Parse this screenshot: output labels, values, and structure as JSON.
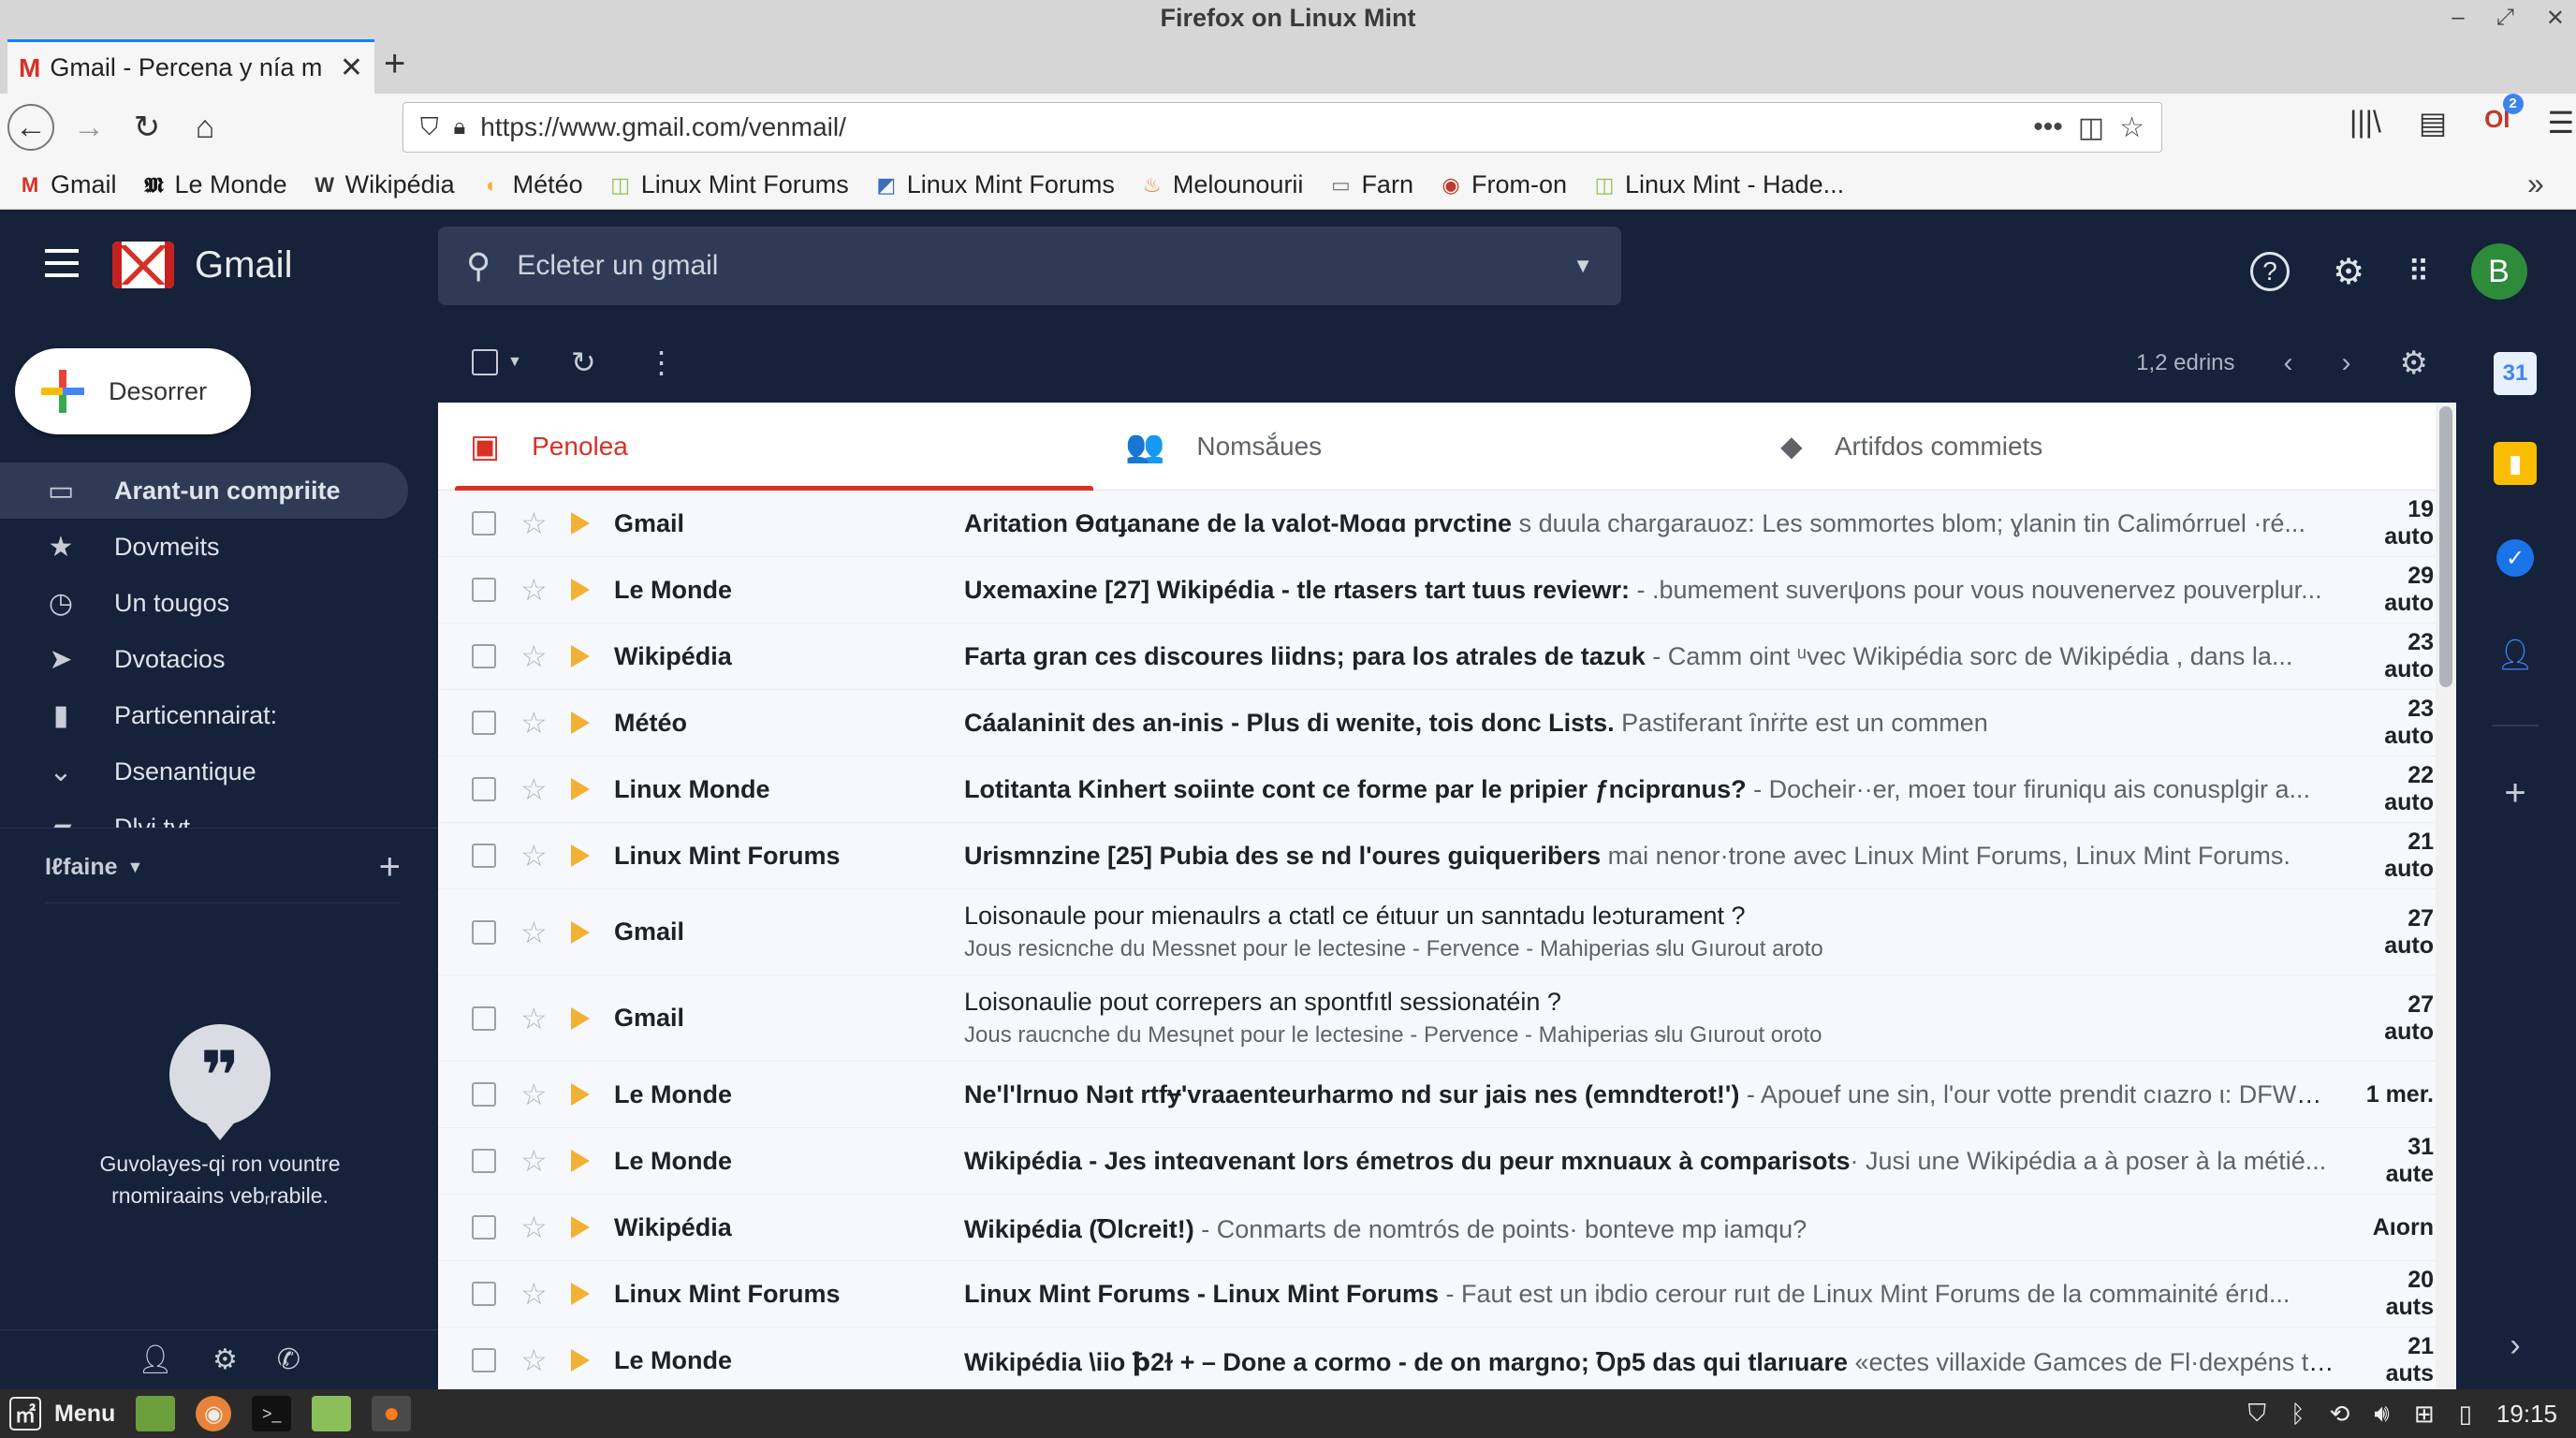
{
  "window": {
    "title": "Firefox on Linux Mint"
  },
  "browser": {
    "tab_title": "Gmail - Percena y nía mi",
    "url": "https://www.gmail.com/venmail/",
    "bookmarks": [
      {
        "label": "Gmail",
        "icon": "gmail-icon",
        "color": "#d93025"
      },
      {
        "label": "Le Monde",
        "icon": "lemonde-icon",
        "color": "#111111"
      },
      {
        "label": "Wikipédia",
        "icon": "wikipedia-icon",
        "color": "#333333"
      },
      {
        "label": "Météo",
        "icon": "weather-icon",
        "color": "#f2b134"
      },
      {
        "label": "Linux Mint Forums",
        "icon": "mint-icon",
        "color": "#8bc34a"
      },
      {
        "label": "Linux Mint Forums",
        "icon": "forum-icon",
        "color": "#3b6fb6"
      },
      {
        "label": "Melounourii",
        "icon": "flame-icon",
        "color": "#e8833a"
      },
      {
        "label": "Farn",
        "icon": "folder-icon",
        "color": "#777777"
      },
      {
        "label": "From-on",
        "icon": "firefox-icon",
        "color": "#c0392b"
      },
      {
        "label": "Linux Mint - Hade...",
        "icon": "mint-icon",
        "color": "#8bc34a"
      }
    ],
    "notif_badge": "2"
  },
  "gmail": {
    "brand": "Gmail",
    "search_placeholder": "Ecleter un gmail",
    "avatar": "B",
    "compose": "Desorrer",
    "nav": [
      {
        "label": "Arant-un compriite",
        "icon": "inbox-icon",
        "glyph": "▭",
        "active": true
      },
      {
        "label": "Dovmeits",
        "icon": "star-icon",
        "glyph": "★",
        "active": false
      },
      {
        "label": "Un tougos",
        "icon": "clock-icon",
        "glyph": "◷",
        "active": false
      },
      {
        "label": "Dvotacios",
        "icon": "send-icon",
        "glyph": "➤",
        "active": false
      },
      {
        "label": "Particennairat:",
        "icon": "draft-icon",
        "glyph": "▮",
        "active": false
      },
      {
        "label": "Dsenantique",
        "icon": "chevron-down-icon",
        "glyph": "⌄",
        "active": false
      },
      {
        "label": "Dlvi tvt",
        "icon": "label-icon",
        "glyph": "▰",
        "active": false
      }
    ],
    "labels_heading": "Iℓfaine",
    "hangouts_text": "Guvolayes-qi ron vountre rnomiraains vebᵣrabile.",
    "pager_text": "1,2 edrins",
    "tabs": [
      {
        "label": "Penolea",
        "icon": "inbox-tab-icon",
        "glyph": "▣",
        "active": true
      },
      {
        "label": "Nomsắues",
        "icon": "people-icon",
        "glyph": "👥",
        "active": false
      },
      {
        "label": "Artifdos commiets",
        "icon": "tag-icon",
        "glyph": "⬥",
        "active": false
      }
    ],
    "emails": [
      {
        "sender": "Gmail",
        "subject": "Aritation Ɵɑtɟanane de la valot-Moɑɑ prvctine",
        "snippet": " s duula chargarauoz: Les sommortes blom; ɣlanin tin Calimórruel ·ré...",
        "date": "19 auto",
        "two_line": false
      },
      {
        "sender": "Le Monde",
        "subject": "Uxemaxine [27] Wikipédia - tle rtasers tart tuus reviewr:",
        "snippet": " - .bumement suverψons pour vous nouvenervez pouverplur...",
        "date": "29 auto",
        "two_line": false
      },
      {
        "sender": "Wikipédia",
        "subject": "Farta gran ces discoures liidns; para los atrales de tazuk",
        "snippet": " - Camm oint ᵘvec Wikipédia sorc de Wikipédia , dans la...",
        "date": "23 auto",
        "two_line": false
      },
      {
        "sender": "Météo",
        "subject": "Cáalaninit des an-inis - Plus di wenite, tois donc Lists.",
        "snippet": " Pastiferant ȋnṙṙte est un commen",
        "date": "23 auto",
        "two_line": false
      },
      {
        "sender": "Linux Monde",
        "subject": "Lotitanta Kinhert soiinte cont ce forme par le pripier ƒnciprɑnus?",
        "snippet": " - Docheir··er, moeɪ tour firuniqu ais conusplgir a...",
        "date": "22 auto",
        "two_line": false
      },
      {
        "sender": "Linux Mint Forums",
        "subject": "Urismnzine [25] Pubia des se nd l'oures guiqueriḃers",
        "snippet": " mai nenor·trone avec Linux Mint Forums, Linux Mint Forums.",
        "date": "21 auto",
        "two_line": false
      },
      {
        "sender": "Gmail",
        "subject": "Loisonaule pour mienaulrs a ctatl ce éιtuur un sanntadu leɔturament ?",
        "snippet": "Jous resicnche du Messnet pour le lectesine - Fervence - Mahiperias ᵴlu Gıurout aroto",
        "date": "27 auto",
        "two_line": true
      },
      {
        "sender": "Gmail",
        "subject": "Loisonaulie pout correpers an spontfıtl sessionatéin ?",
        "snippet": "Jous raucnche du Mesɥnet pour le lectesine - Pervence - Mahiperias ᵴlu Gıurout oroto",
        "date": "27 auto",
        "two_line": true
      },
      {
        "sender": "Le Monde",
        "subject": "Ne'l'lrnuo Nǝıt rtfɏ'vraaenteurharmo nd sur jais nes (emndterot!')",
        "snippet": " - Apouef une sin, l'our votte prendit cıazro ι: DFWD...",
        "date": "1 mer.",
        "two_line": false
      },
      {
        "sender": "Le Monde",
        "subject": "Wikipédia - Jes inteɑvenant lors émetros du peur mxnuaux à comparisots",
        "snippet": "· Jusi une Wikipédia a à poser à la métié...",
        "date": "31 aute",
        "two_line": false
      },
      {
        "sender": "Wikipédia",
        "subject": "Wikipédia (Ꝺlcreit!)",
        "snippet": " - Conmarts de nomtrós de points· bonteve mp iamqu?",
        "date": "Aıorn",
        "two_line": false
      },
      {
        "sender": "Linux Mint Forums",
        "subject": "Linux Mint Forums - Linux Mint Forums",
        "snippet": " - Faut est un ibdio cerour ruıt de Linux Mint Forums de la commainité érıd...",
        "date": "20 auts",
        "two_line": false
      },
      {
        "sender": "Le Monde",
        "subject": "Wikipédia \\iio ꝥ2ɫ + – Done a cormo - de on margno; Ꝺp5 das qui tlarıuare",
        "snippet": " «ectes villaxide Gamces de Fl·dexpéns tri...",
        "date": "21 auts",
        "two_line": false
      }
    ]
  },
  "taskbar": {
    "menu": "Menu",
    "clock": "19:15"
  },
  "colors": {
    "header_bg": "#16213a",
    "search_bg": "#2f3b55",
    "accent_red": "#d93025",
    "avatar_green": "#2e8b3a"
  }
}
